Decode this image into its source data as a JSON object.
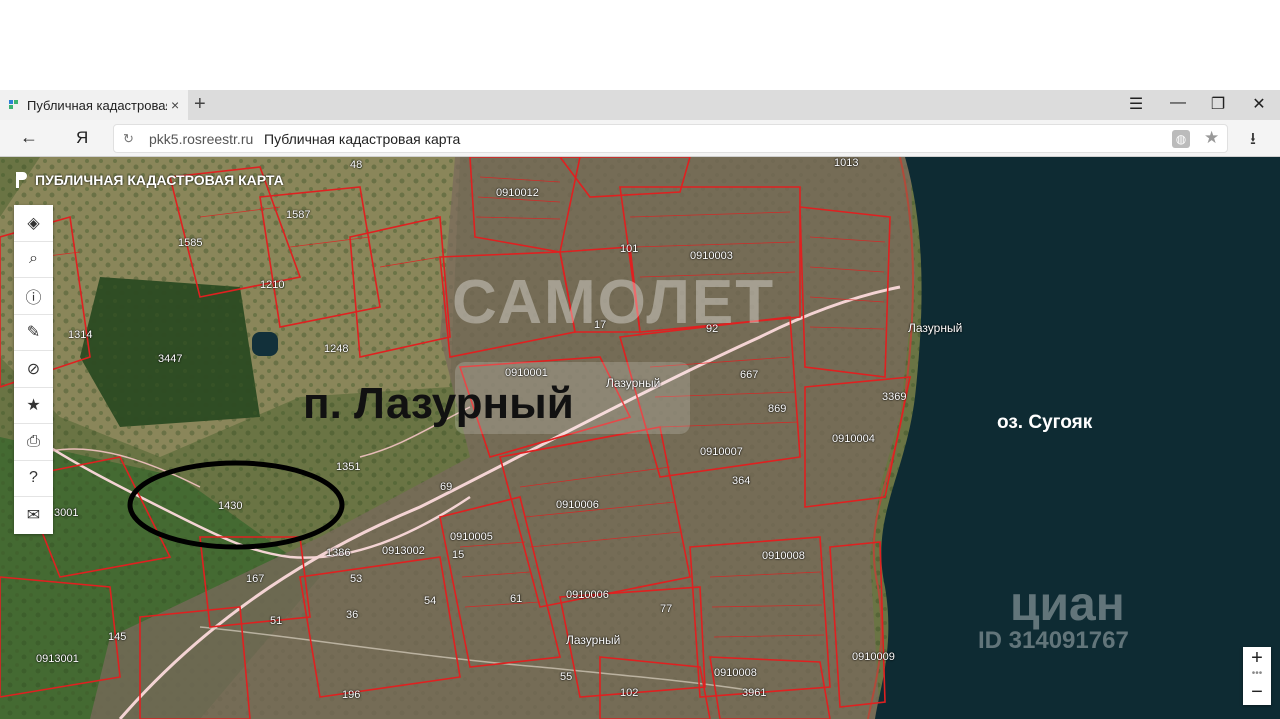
{
  "browser": {
    "tab_title": "Публичная кадастровая",
    "tab_close": "×",
    "new_tab": "+",
    "win_menu": "☰",
    "win_min": "—",
    "win_max": "❐",
    "win_close": "✕",
    "back": "←",
    "ya": "Я",
    "reload": "↻",
    "domain": "pkk5.rosreestr.ru",
    "page_title": "Публичная кадастровая карта",
    "download": "⭳"
  },
  "app": {
    "brand": "ПУБЛИЧНАЯ КАДАСТРОВАЯ КАРТА",
    "tools": [
      {
        "name": "layers-icon",
        "glyph": "◈"
      },
      {
        "name": "search-icon",
        "glyph": "⌕"
      },
      {
        "name": "info-icon",
        "glyph": "ⓘ"
      },
      {
        "name": "pencil-icon",
        "glyph": "✎"
      },
      {
        "name": "no-edit-icon",
        "glyph": "⊘"
      },
      {
        "name": "star-icon",
        "glyph": "★"
      },
      {
        "name": "print-icon",
        "glyph": "⎙"
      },
      {
        "name": "help-icon",
        "glyph": "?"
      },
      {
        "name": "mail-icon",
        "glyph": "✉"
      }
    ],
    "zoom_in": "+",
    "zoom_sep": "•••",
    "zoom_out": "−"
  },
  "map": {
    "settlement_label": "п. Лазурный",
    "lake_label": "оз. Сугояк",
    "place_labels": [
      "Лазурный",
      "Лазурный",
      "Лазурный"
    ],
    "watermarks": [
      "САМОЛЕТ",
      "циан",
      "ID 314091767"
    ],
    "parcel_labels": [
      "0910012",
      "0910003",
      "0910001",
      "0910007",
      "0910004",
      "0910006",
      "0910005",
      "0913002",
      "0910006",
      "0910008",
      "0910008",
      "0913001",
      "3001",
      "3447",
      "1430",
      "1351",
      "1386",
      "1013",
      "1314",
      "1585",
      "1587",
      "1210",
      "1248",
      "3961",
      "869",
      "364",
      "667",
      "55",
      "102",
      "196",
      "145",
      "167",
      "51",
      "53",
      "54",
      "36",
      "69",
      "48",
      "15",
      "61",
      "17",
      "77",
      "92",
      "101",
      "3369",
      "0910009"
    ]
  }
}
